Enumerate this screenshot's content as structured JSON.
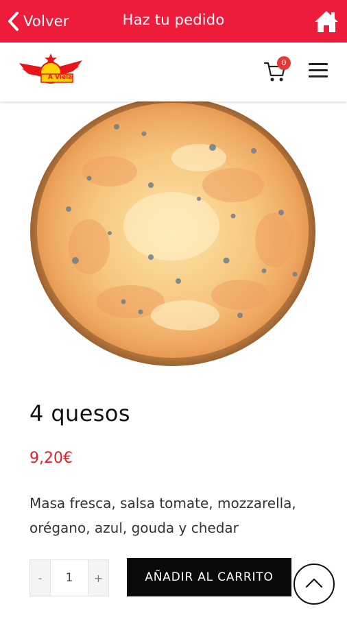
{
  "topbar": {
    "back_label": "Volver",
    "title": "Haz tu pedido",
    "background_color": "#ee1c3b"
  },
  "header": {
    "logo_text": "A Viela",
    "cart_count": "0"
  },
  "product": {
    "name": "4 quesos",
    "price": "9,20€",
    "description": "Masa fresca, salsa tomate, mozzarella, orégano, azul, gouda y chedar",
    "image": "pizza-4-quesos"
  },
  "order": {
    "decrement_label": "-",
    "quantity": "1",
    "increment_label": "+",
    "add_to_cart_label": "AÑADIR AL CARRITO"
  },
  "icons": {
    "back": "chevron-left-icon",
    "home": "home-icon",
    "cart": "cart-icon",
    "menu": "hamburger-menu-icon",
    "scroll_top": "chevron-up-icon"
  },
  "colors": {
    "accent": "#ee1c3b",
    "price": "#e0202a",
    "button": "#0a0a0a"
  }
}
